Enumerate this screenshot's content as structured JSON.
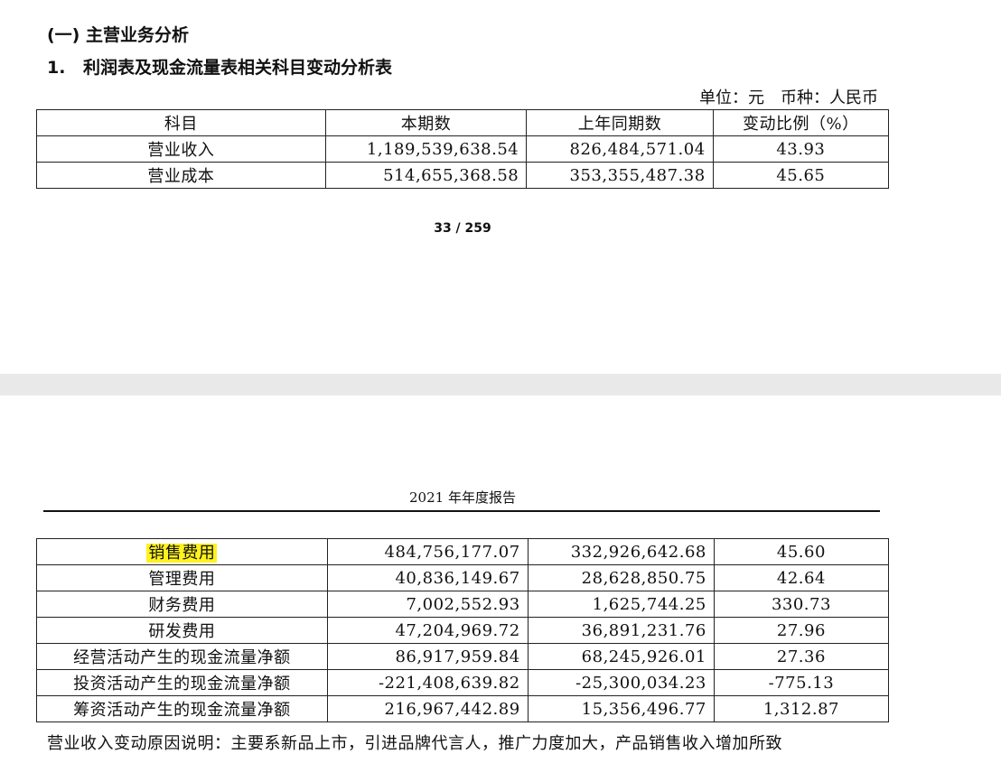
{
  "section_title": "(一) 主营业务分析",
  "subsection": {
    "number": "1.",
    "title": "利润表及现金流量表相关科目变动分析表"
  },
  "unit_note": {
    "unit": "单位：元",
    "currency": "币种：人民币"
  },
  "table_header": [
    "科目",
    "本期数",
    "上年同期数",
    "变动比例（%）"
  ],
  "rows_page1": [
    [
      "营业收入",
      "1,189,539,638.54",
      "826,484,571.04",
      "43.93"
    ],
    [
      "营业成本",
      "514,655,368.58",
      "353,355,487.38",
      "45.65"
    ]
  ],
  "page_number": "33 / 259",
  "running_header": "2021 年年度报告",
  "rows_page2": [
    [
      "销售费用",
      "484,756,177.07",
      "332,926,642.68",
      "45.60"
    ],
    [
      "管理费用",
      "40,836,149.67",
      "28,628,850.75",
      "42.64"
    ],
    [
      "财务费用",
      "7,002,552.93",
      "1,625,744.25",
      "330.73"
    ],
    [
      "研发费用",
      "47,204,969.72",
      "36,891,231.76",
      "27.96"
    ],
    [
      "经营活动产生的现金流量净额",
      "86,917,959.84",
      "68,245,926.01",
      "27.36"
    ],
    [
      "投资活动产生的现金流量净额",
      "-221,408,639.82",
      "-25,300,034.23",
      "-775.13"
    ],
    [
      "筹资活动产生的现金流量净额",
      "216,967,442.89",
      "15,356,496.77",
      "1,312.87"
    ]
  ],
  "note": "营业收入变动原因说明：主要系新品上市，引进品牌代言人，推广力度加大，产品销售收入增加所致",
  "highlight_color": "#fff21e"
}
